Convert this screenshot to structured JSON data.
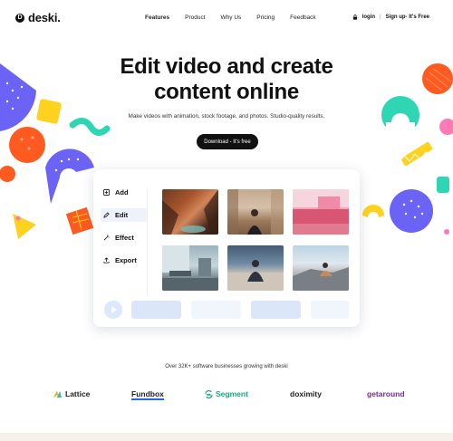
{
  "brand": {
    "mark": "D",
    "name": "deski."
  },
  "nav": {
    "items": [
      "Features",
      "Product",
      "Why Us",
      "Pricing",
      "Feedback"
    ],
    "active": "Features"
  },
  "auth": {
    "login": "login",
    "separator": "|",
    "signup": "Sign up- It's Free"
  },
  "hero": {
    "title_line1": "Edit video and create",
    "title_line2": "content online",
    "subtitle": "Make videos with animation, stock footage, and photos. Studio-quality results.",
    "cta": "Download - It's free"
  },
  "editor": {
    "menu": [
      {
        "label": "Add",
        "icon": "plus-square-icon"
      },
      {
        "label": "Edit",
        "icon": "pencil-icon",
        "active": true
      },
      {
        "label": "Effect",
        "icon": "magic-wand-icon"
      },
      {
        "label": "Export",
        "icon": "upload-icon"
      }
    ],
    "thumbnails": [
      "canyon-photo",
      "woman-in-city-photo",
      "pink-building-photo",
      "office-interior-photo",
      "man-sitting-photo",
      "woman-on-rocks-photo"
    ]
  },
  "trust": {
    "text": "Over 32K+ software businesses growing with deski"
  },
  "logos": [
    "Lattice",
    "Fundbox",
    "Segment",
    "doximity",
    "getaround"
  ],
  "colors": {
    "accent_dark": "#111111",
    "purple": "#6b63f6",
    "orange": "#ff5a1f",
    "yellow": "#ffd21f",
    "mint": "#2fd6b4",
    "pink": "#ff7ab6",
    "timeline_blue": "#dbe6f9"
  }
}
